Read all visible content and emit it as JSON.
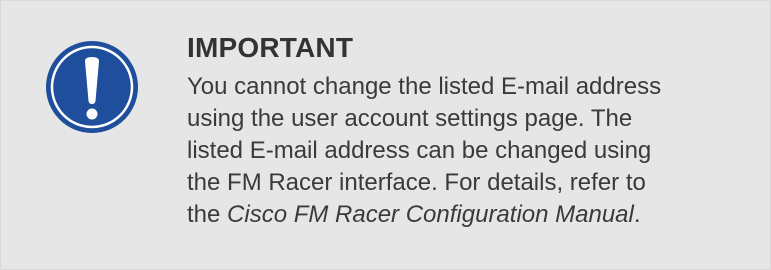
{
  "notice": {
    "type": "important",
    "icon": "exclamation-icon",
    "icon_color": "#1f4e9c",
    "background_color": "#e6e6e6",
    "heading": "IMPORTANT",
    "lines": [
      "You cannot change the listed E-mail address",
      "using the user account settings page. The",
      "listed E-mail address can be changed using",
      "the FM Racer interface. For details, refer to"
    ],
    "last_line_prefix": "the ",
    "manual_title": "Cisco FM Racer Configuration Manual",
    "last_line_suffix": "."
  }
}
